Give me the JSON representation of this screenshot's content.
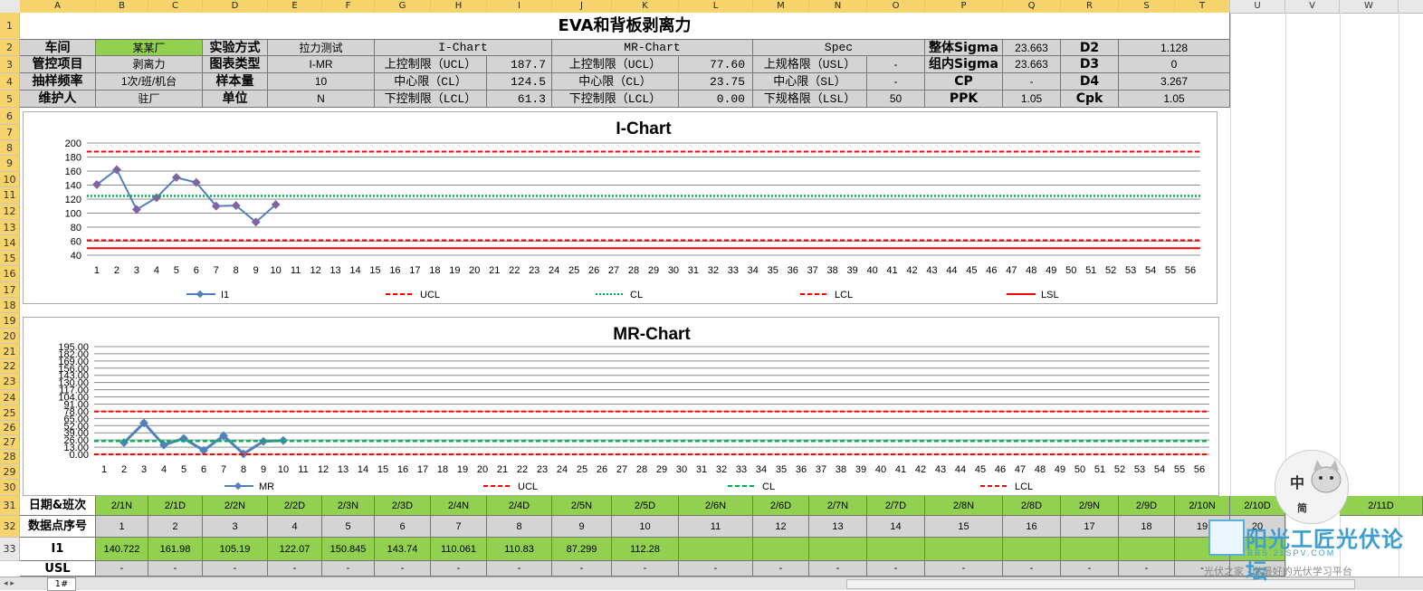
{
  "columns": [
    "A",
    "B",
    "C",
    "D",
    "E",
    "F",
    "G",
    "H",
    "I",
    "J",
    "K",
    "L",
    "M",
    "N",
    "O",
    "P",
    "Q",
    "R",
    "S",
    "T",
    "U",
    "V",
    "W"
  ],
  "rows": [
    "1",
    "2",
    "3",
    "4",
    "5",
    "6",
    "7",
    "8",
    "9",
    "10",
    "11",
    "12",
    "13",
    "14",
    "15",
    "16",
    "17",
    "18",
    "19",
    "20",
    "21",
    "22",
    "23",
    "24",
    "25",
    "26",
    "27",
    "28",
    "29",
    "30",
    "31",
    "32",
    "33"
  ],
  "title": "EVA和背板剥离力",
  "info": {
    "r2": [
      "车间",
      "某某厂",
      "实验方式",
      "拉力测试",
      "I-Chart",
      "MR-Chart",
      "Spec",
      "整体Sigma",
      "23.663",
      "D2",
      "1.128"
    ],
    "r3": [
      "管控项目",
      "剥离力",
      "图表类型",
      "I-MR",
      "上控制限（UCL）",
      "187.7",
      "上控制限（UCL）",
      "77.60",
      "上规格限（USL）",
      "-",
      "组内Sigma",
      "23.663",
      "D3",
      "0"
    ],
    "r4": [
      "抽样频率",
      "1次/班/机台",
      "样本量",
      "10",
      "中心限（CL）",
      "124.5",
      "中心限（CL）",
      "23.75",
      "中心限（SL）",
      "-",
      "CP",
      "-",
      "D4",
      "3.267"
    ],
    "r5": [
      "维护人",
      "驻厂",
      "单位",
      "N",
      "下控制限（LCL）",
      "61.3",
      "下控制限（LCL）",
      "0.00",
      "下规格限（LSL）",
      "50",
      "PPK",
      "1.05",
      "Cpk",
      "1.05"
    ]
  },
  "chart_data": [
    {
      "type": "line",
      "title": "I-Chart",
      "x": [
        "1",
        "2",
        "3",
        "4",
        "5",
        "6",
        "7",
        "8",
        "9",
        "10",
        "11",
        "12",
        "13",
        "14",
        "15",
        "16",
        "17",
        "18",
        "19",
        "20",
        "21",
        "22",
        "23",
        "24",
        "25",
        "26",
        "27",
        "28",
        "29",
        "30",
        "31",
        "32",
        "33",
        "34",
        "35",
        "36",
        "37",
        "38",
        "39",
        "40",
        "41",
        "42",
        "43",
        "44",
        "45",
        "46",
        "47",
        "48",
        "49",
        "50",
        "51",
        "52",
        "53",
        "54",
        "55",
        "56"
      ],
      "ylim": [
        40,
        200
      ],
      "yticks": [
        "200",
        "180",
        "160",
        "140",
        "120",
        "100",
        "80",
        "60",
        "40"
      ],
      "series": [
        {
          "name": "I1",
          "values": [
            140.722,
            161.98,
            105.19,
            122.07,
            150.845,
            143.74,
            110.061,
            110.83,
            87.299,
            112.28
          ],
          "color": "#4f81bd",
          "style": "solid-marker"
        },
        {
          "name": "UCL",
          "constant": 187.7,
          "color": "#ff0000",
          "style": "dash"
        },
        {
          "name": "CL",
          "constant": 124.5,
          "color": "#00b050",
          "style": "dot"
        },
        {
          "name": "LCL",
          "constant": 61.3,
          "color": "#ff0000",
          "style": "dash"
        },
        {
          "name": "LSL",
          "constant": 50,
          "color": "#ff0000",
          "style": "solid"
        }
      ]
    },
    {
      "type": "line",
      "title": "MR-Chart",
      "x": [
        "1",
        "2",
        "3",
        "4",
        "5",
        "6",
        "7",
        "8",
        "9",
        "10",
        "11",
        "12",
        "13",
        "14",
        "15",
        "16",
        "17",
        "18",
        "19",
        "20",
        "21",
        "22",
        "23",
        "24",
        "25",
        "26",
        "27",
        "28",
        "29",
        "30",
        "31",
        "32",
        "33",
        "34",
        "35",
        "36",
        "37",
        "38",
        "39",
        "40",
        "41",
        "42",
        "43",
        "44",
        "45",
        "46",
        "47",
        "48",
        "49",
        "50",
        "51",
        "52",
        "53",
        "54",
        "55",
        "56"
      ],
      "ylim": [
        0,
        195
      ],
      "yticks": [
        "195.00",
        "182.00",
        "169.00",
        "156.00",
        "143.00",
        "130.00",
        "117.00",
        "104.00",
        "91.00",
        "78.00",
        "65.00",
        "52.00",
        "39.00",
        "26.00",
        "13.00",
        "0.00"
      ],
      "series": [
        {
          "name": "MR",
          "x_start": 2,
          "values": [
            21.26,
            56.79,
            16.88,
            28.78,
            7.11,
            33.68,
            0.77,
            23.53,
            24.98
          ],
          "color": "#4f81bd",
          "style": "solid-marker"
        },
        {
          "name": "UCL",
          "constant": 77.6,
          "color": "#ff0000",
          "style": "dash"
        },
        {
          "name": "CL",
          "constant": 23.75,
          "color": "#00b050",
          "style": "dash"
        },
        {
          "name": "LCL",
          "constant": 0,
          "color": "#ff0000",
          "style": "dash"
        }
      ]
    }
  ],
  "bottom": {
    "r30_label": "日期&班次",
    "r30": [
      "2/1N",
      "2/1D",
      "2/2N",
      "2/2D",
      "2/3N",
      "2/3D",
      "2/4N",
      "2/4D",
      "2/5N",
      "2/5D",
      "2/6N",
      "2/6D",
      "2/7N",
      "2/7D",
      "2/8N",
      "2/8D",
      "2/9N",
      "2/9D",
      "2/10N",
      "2/10D",
      "2/11D"
    ],
    "r31_label": "数据点序号",
    "r31": [
      "1",
      "2",
      "3",
      "4",
      "5",
      "6",
      "7",
      "8",
      "9",
      "10",
      "11",
      "12",
      "13",
      "14",
      "15",
      "16",
      "17",
      "18",
      "19",
      "20"
    ],
    "r32_label": "I1",
    "r32": [
      "140.722",
      "161.98",
      "105.19",
      "122.07",
      "150.845",
      "143.74",
      "110.061",
      "110.83",
      "87.299",
      "112.28"
    ],
    "r33_label": "USL",
    "r33_dash": "-"
  },
  "sheet_tab": "1#",
  "watermark": {
    "forum": "阳光工匠光伏论坛",
    "url": "BBS.21SPV.COM",
    "slogan": "光伏之家 · 做最好的光伏学习平台",
    "stamp1": "中",
    "stamp2": "简"
  }
}
